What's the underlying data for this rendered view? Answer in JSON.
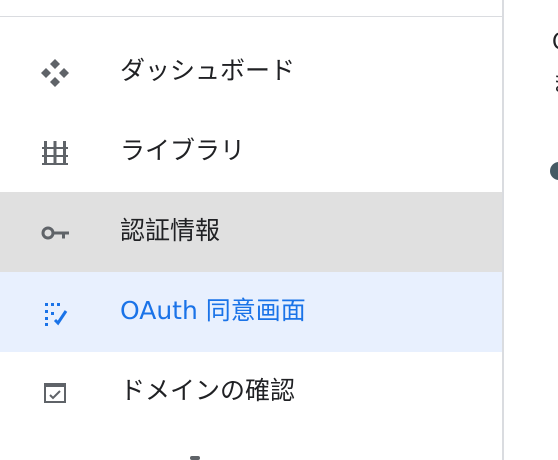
{
  "sidebar": {
    "items": [
      {
        "label": "ダッシュボード",
        "icon": "dashboard-icon",
        "state": "default"
      },
      {
        "label": "ライブラリ",
        "icon": "library-icon",
        "state": "default"
      },
      {
        "label": "認証情報",
        "icon": "key-icon",
        "state": "selected"
      },
      {
        "label": "OAuth 同意画面",
        "icon": "oauth-consent-icon",
        "state": "hover"
      },
      {
        "label": "ドメインの確認",
        "icon": "domain-verification-icon",
        "state": "default"
      }
    ]
  },
  "colors": {
    "selected_bg": "#e0e0e0",
    "hover_bg": "#e8f0fe",
    "accent": "#1a73e8",
    "icon": "#5f6368",
    "text": "#202124",
    "divider": "#dadce0"
  }
}
